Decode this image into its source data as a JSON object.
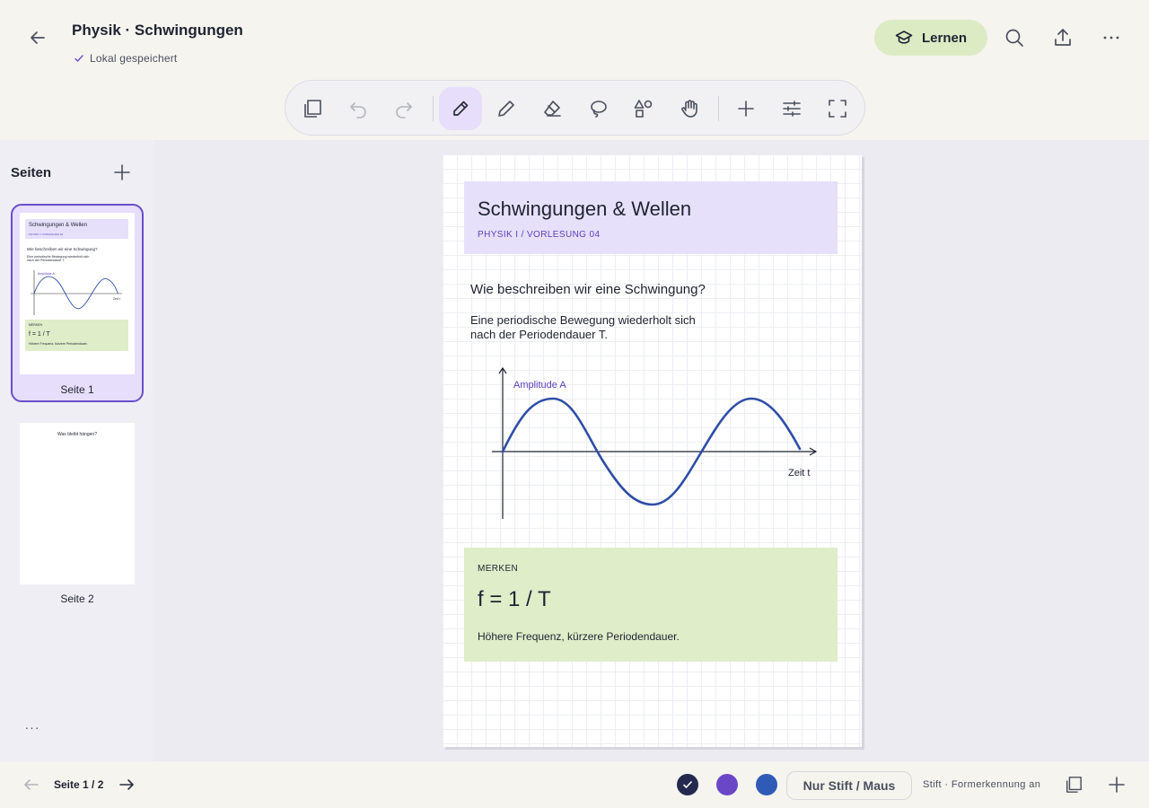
{
  "header": {
    "title": "Physik · Schwingungen",
    "save_status": "Lokal gespeichert",
    "learn_label": "Lernen"
  },
  "sidebar": {
    "title": "Seiten",
    "pages": [
      {
        "label": "Seite 1",
        "selected": true
      },
      {
        "label": "Seite 2",
        "selected": false
      }
    ],
    "more": "···"
  },
  "thumb1": {
    "title": "Schwingungen & Wellen",
    "subtitle": "PHYSIK I / VORLESUNG 04",
    "question": "Wie beschreiben wir eine Schwingung?",
    "desc_line1": "Eine periodische Bewegung wiederholt sich",
    "desc_line2": "nach der Periodendauer T.",
    "amp": "Amplitude A",
    "time": "Zeit t",
    "memo_label": "MERKEN",
    "memo_formula": "f = 1 / T",
    "memo_note": "Höhere Frequenz, kürzere Periodendauer."
  },
  "thumb2": {
    "question": "Was bleibt hängen?"
  },
  "page": {
    "title": "Schwingungen & Wellen",
    "subtitle": "PHYSIK  I   /   VORLESUNG 04",
    "question": "Wie beschreiben wir eine Schwingung?",
    "desc_line1": "Eine periodische Bewegung wiederholt sich",
    "desc_line2": "nach der Periodendauer T.",
    "axis_y_label": "Amplitude A",
    "axis_x_label": "Zeit t",
    "memo_label": "MERKEN",
    "memo_formula": "f = 1 / T",
    "memo_note": "Höhere Frequenz, kürzere Periodendauer."
  },
  "bottombar": {
    "page_indicator": "Seite 1 / 2",
    "pen_mode": "Nur Stift / Maus",
    "status": "Stift · Formerkennung an"
  },
  "colors": {
    "accent": "#6a4fc9",
    "swatch_1": "#232a4d",
    "swatch_2": "#6a47c6",
    "swatch_3": "#2f5bb7",
    "wave": "#2f4ea6",
    "learn_bg": "#dcebc4",
    "title_box_bg": "#e6e0fb",
    "memo_bg": "#dfedc9"
  }
}
